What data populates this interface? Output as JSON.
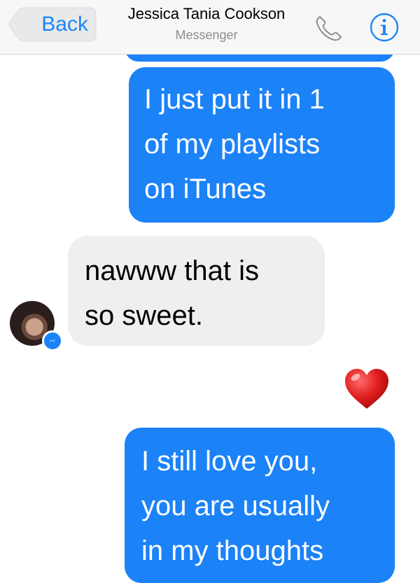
{
  "header": {
    "back_label": "Back",
    "title": "Jessica Tania Cookson",
    "subtitle": "Messenger",
    "call_icon": "phone-icon",
    "info_icon": "info-icon"
  },
  "messages": [
    {
      "sender": "me",
      "lines": [
        "I just put it in 1",
        "of my playlists",
        "on iTunes"
      ]
    },
    {
      "sender": "contact",
      "lines": [
        "nawww that is",
        "so sweet."
      ]
    },
    {
      "sender": "me",
      "type": "emoji",
      "icon": "heart-emoji"
    },
    {
      "sender": "me",
      "lines": [
        "I still love you,",
        "you are usually",
        "in my thoughts"
      ]
    }
  ],
  "colors": {
    "accent": "#1a86f7",
    "sent_bubble": "#1b82f8",
    "received_bubble": "#efeff1",
    "header_bg": "#f7f7f8"
  }
}
